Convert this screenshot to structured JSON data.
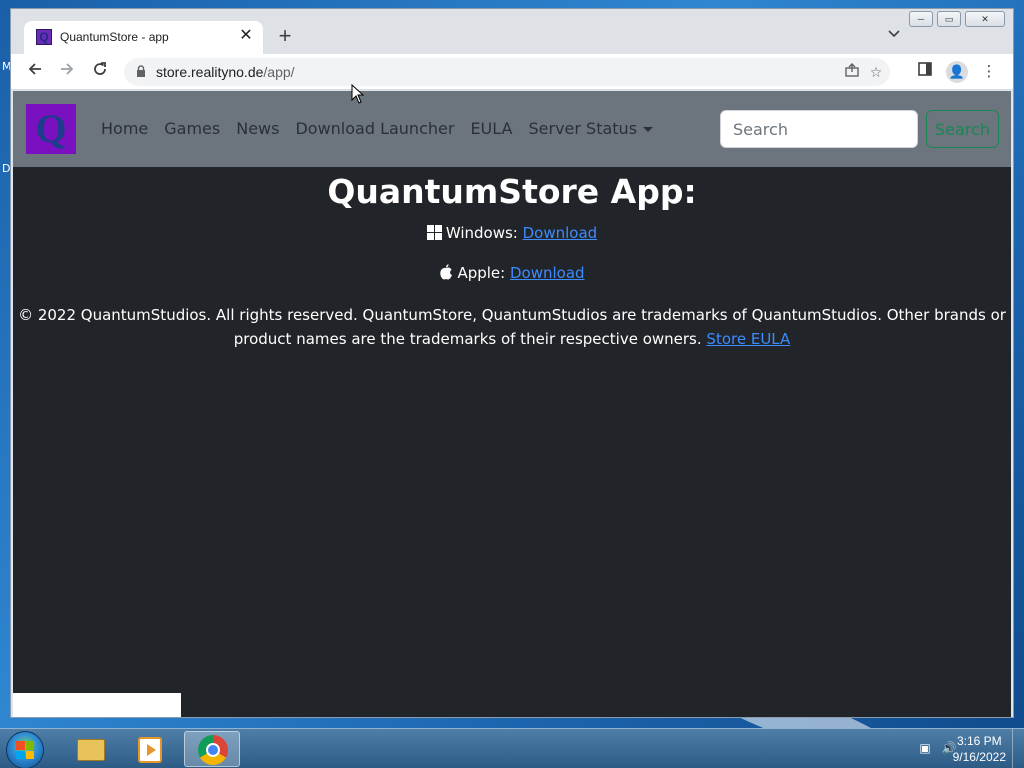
{
  "desktop": {
    "edge_letters": [
      "M",
      "D"
    ]
  },
  "browser": {
    "tab_title": "QuantumStore - app",
    "tab_favicon_letter": "Q",
    "url_host": "store.realityno.de",
    "url_path": "/app/",
    "window_controls": {
      "minimize": "─",
      "maximize": "▭",
      "close": "✕"
    }
  },
  "site": {
    "brand_letter": "Q",
    "nav": [
      {
        "label": "Home"
      },
      {
        "label": "Games"
      },
      {
        "label": "News"
      },
      {
        "label": "Download Launcher"
      },
      {
        "label": "EULA"
      },
      {
        "label": "Server Status"
      }
    ],
    "search": {
      "placeholder": "Search",
      "button_label": "Search"
    },
    "heading": "QuantumStore App:",
    "windows": {
      "label": "Windows:",
      "link": "Download"
    },
    "apple": {
      "label": "Apple:",
      "link": "Download"
    },
    "footer": {
      "text": "© 2022 QuantumStudios. All rights reserved. QuantumStore, QuantumStudios are trademarks of QuantumStudios. Other brands or product names are the trademarks of their respective owners.",
      "link": "Store EULA"
    }
  },
  "taskbar": {
    "time": "3:16 PM",
    "date": "9/16/2022"
  },
  "colors": {
    "page_bg": "#212529",
    "navbar_bg": "#6c757d",
    "link": "#3d8bfd",
    "search_button": "#198754",
    "brand_bg": "#7a10c0"
  }
}
